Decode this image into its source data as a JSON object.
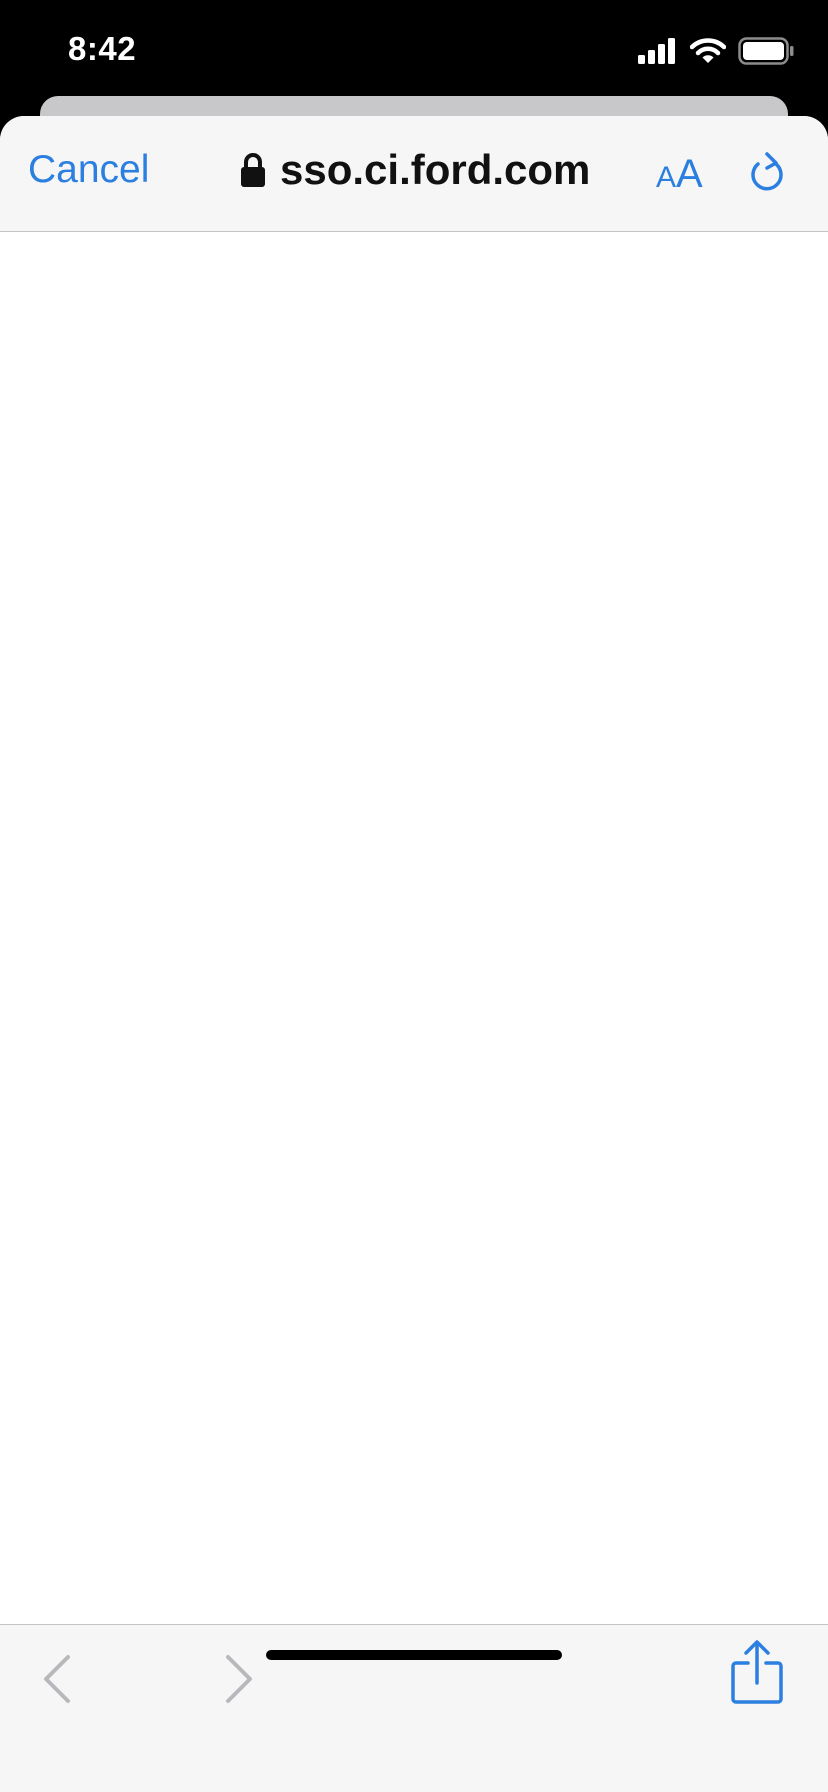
{
  "status_bar": {
    "time": "8:42",
    "signal_icon": "cellular-signal-icon",
    "wifi_icon": "wifi-icon",
    "battery_icon": "battery-icon",
    "battery_level": 1.0
  },
  "nav_bar": {
    "cancel_label": "Cancel",
    "lock_icon": "lock-icon",
    "url": "sso.ci.ford.com",
    "text_size_small": "A",
    "text_size_large": "A",
    "reload_icon": "reload-icon"
  },
  "toolbar": {
    "back_icon": "chevron-left-icon",
    "back_enabled": false,
    "forward_icon": "chevron-right-icon",
    "forward_enabled": false,
    "share_icon": "share-icon"
  },
  "colors": {
    "accent": "#2b7fe0",
    "bar_background": "#f6f6f6",
    "disabled": "#b9b9bd"
  }
}
